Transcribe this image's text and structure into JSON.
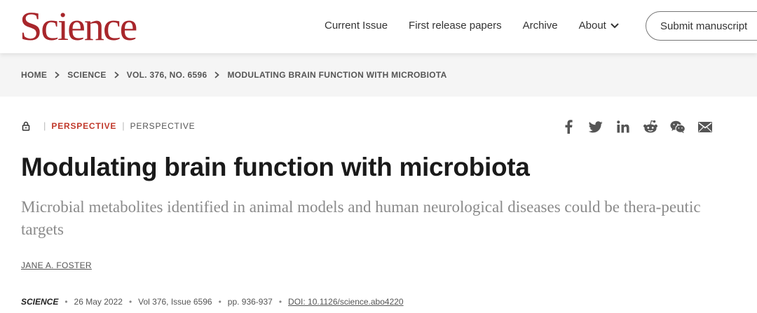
{
  "header": {
    "logo": "Science",
    "nav": [
      "Current Issue",
      "First release papers",
      "Archive",
      "About"
    ],
    "submit_label": "Submit manuscript"
  },
  "breadcrumb": [
    "HOME",
    "SCIENCE",
    "VOL. 376, NO. 6596",
    "MODULATING BRAIN FUNCTION WITH MICROBIOTA"
  ],
  "article": {
    "type_primary": "PERSPECTIVE",
    "type_secondary": "PERSPECTIVE",
    "title": "Modulating brain function with microbiota",
    "subtitle": "Microbial metabolites identified in animal models and human neurological diseases could be thera-peutic targets",
    "author": "JANE A. FOSTER",
    "journal": "SCIENCE",
    "date": "26 May 2022",
    "volume": "Vol 376, Issue 6596",
    "pages": "pp. 936-937",
    "doi": "DOI: 10.1126/science.abo4220"
  },
  "share_icons": [
    "facebook-icon",
    "twitter-icon",
    "linkedin-icon",
    "reddit-icon",
    "wechat-icon",
    "email-icon"
  ],
  "colors": {
    "brand": "#a8262b",
    "type_accent": "#c0392b"
  }
}
